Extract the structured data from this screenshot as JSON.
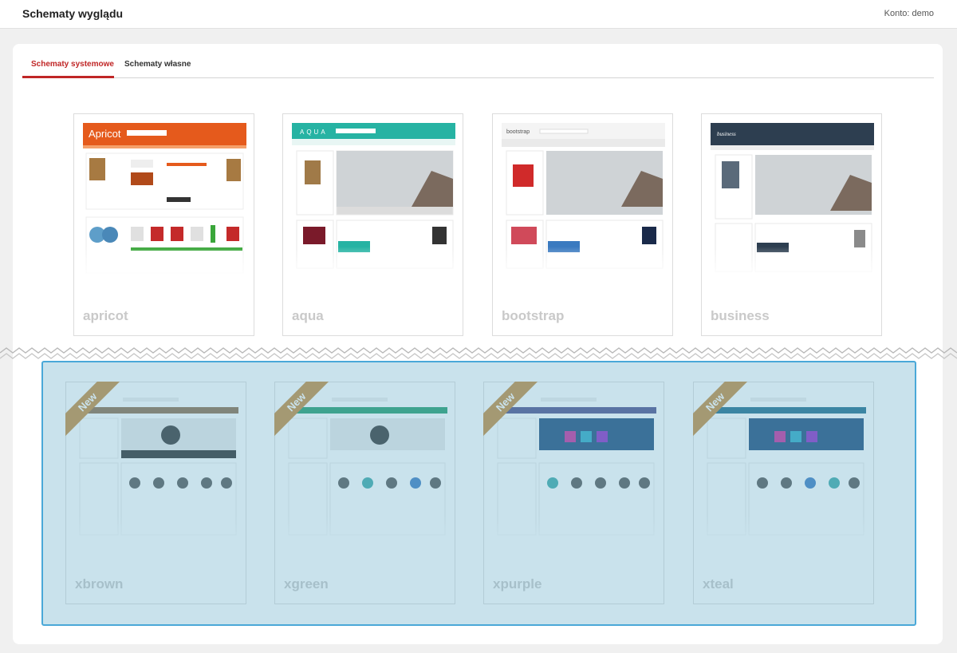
{
  "header": {
    "title": "Schematy wyglądu",
    "account": "Konto: demo"
  },
  "tabs": [
    {
      "label": "Schematy systemowe",
      "active": true
    },
    {
      "label": "Schematy własne",
      "active": false
    }
  ],
  "badge": "New",
  "system_themes": [
    {
      "name": "apricot",
      "logo": "Apricot",
      "accent": "#e55a1c"
    },
    {
      "name": "aqua",
      "logo": "AQUA",
      "accent": "#26b3a3"
    },
    {
      "name": "bootstrap",
      "logo": "bootstrap",
      "accent": "#e8e8e8"
    },
    {
      "name": "business",
      "logo": "business",
      "accent": "#2d3e50"
    }
  ],
  "new_themes": [
    {
      "name": "xbrown",
      "accent": "#8a6a4a"
    },
    {
      "name": "xgreen",
      "accent": "#1f9a6a"
    },
    {
      "name": "xpurple",
      "accent": "#4b4c8a"
    },
    {
      "name": "xteal",
      "accent": "#1a6a8a"
    }
  ],
  "colors": {
    "active_tab": "#c02626",
    "highlight_border": "#4aa8d8",
    "ribbon": "#c48a3c"
  }
}
